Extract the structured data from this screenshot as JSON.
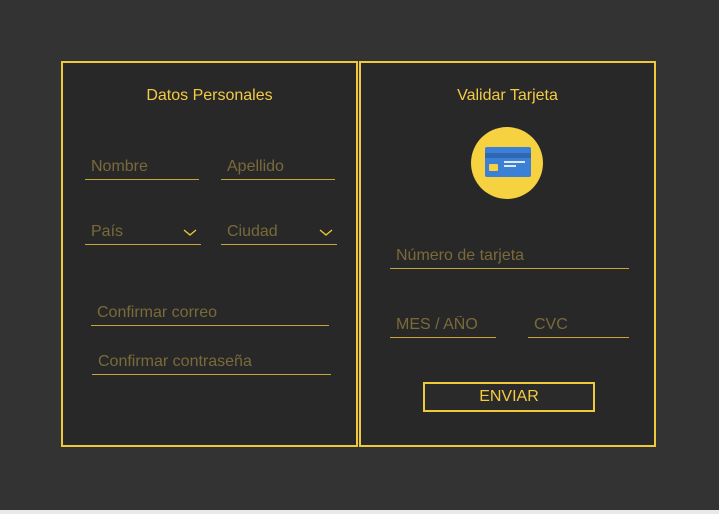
{
  "personal": {
    "title": "Datos Personales",
    "first_name_placeholder": "Nombre",
    "last_name_placeholder": "Apellido",
    "country_select": "País",
    "city_select": "Ciudad",
    "confirm_email_placeholder": "Confirmar correo",
    "confirm_password_placeholder": "Confirmar contraseña"
  },
  "card": {
    "title": "Validar Tarjeta",
    "card_number_placeholder": "Número de tarjeta",
    "expiry_placeholder": "MES / AÑO",
    "cvc_placeholder": "CVC",
    "submit_label": "ENVIAR"
  },
  "colors": {
    "accent": "#f0c93b",
    "background": "#333333",
    "panel": "#282828",
    "placeholder": "#7a6a3a"
  },
  "icons": {
    "card_icon": "credit-card-icon",
    "dropdown_icon": "chevron-down-icon"
  }
}
